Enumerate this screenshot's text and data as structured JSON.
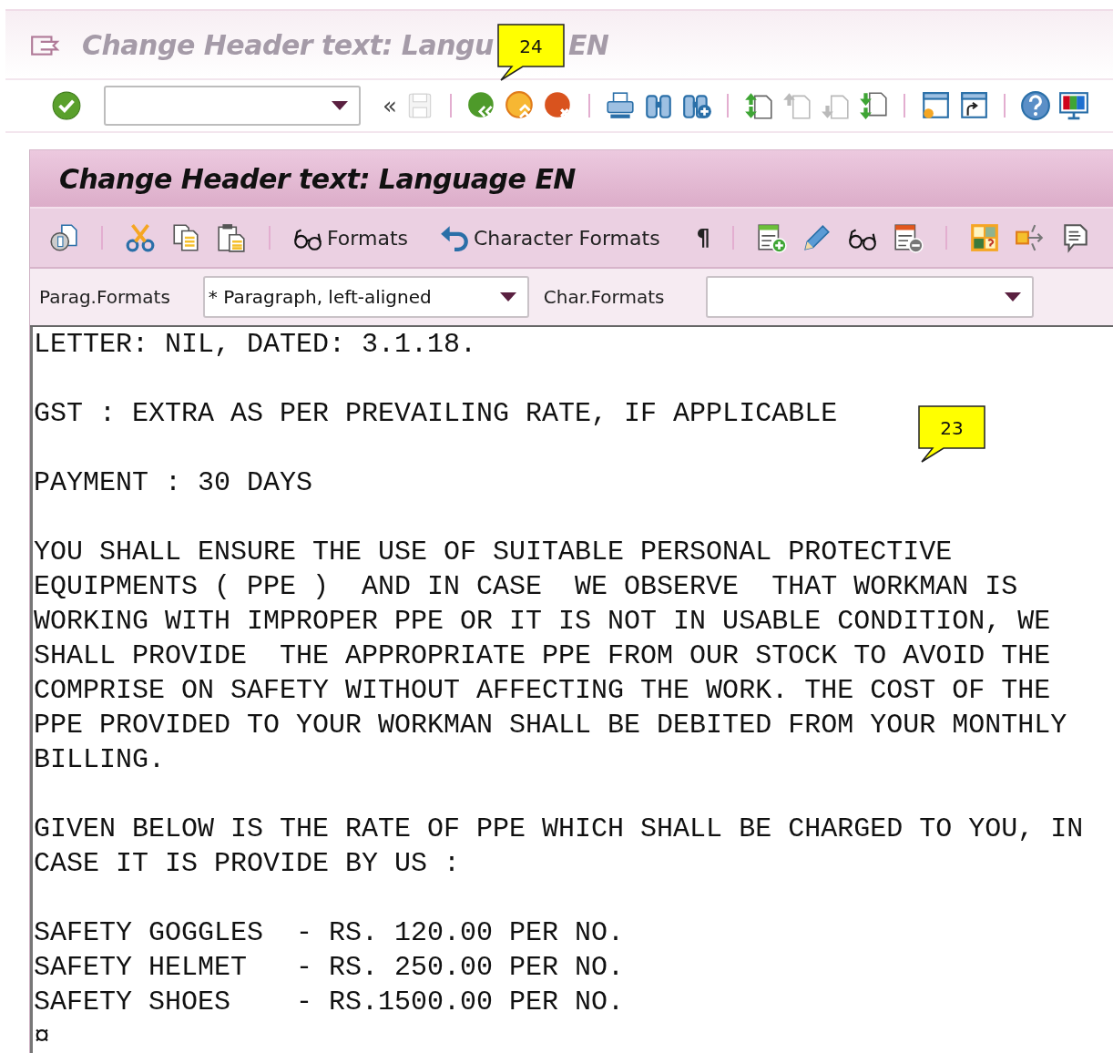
{
  "window": {
    "title": "Change Header text: Langu",
    "title_end": "EN"
  },
  "toolbar": {
    "nav_glyph": "«",
    "buttons": [
      {
        "disabled": false
      },
      {
        "disabled": true
      },
      {
        "disabled": false
      },
      {
        "disabled": false
      },
      {
        "disabled": false
      },
      {
        "disabled": false
      },
      {
        "disabled": false
      },
      {
        "disabled": false
      },
      {
        "disabled": false
      },
      {
        "disabled": true
      },
      {
        "disabled": true
      },
      {
        "disabled": false
      },
      {
        "disabled": false
      },
      {
        "disabled": false
      },
      {
        "disabled": false
      },
      {
        "disabled": false
      }
    ]
  },
  "callouts": [
    {
      "text": "24"
    },
    {
      "text": "23"
    }
  ],
  "screen": {
    "title": "Change Header text: Language EN"
  },
  "app_toolbar": {
    "formats_button": "Formats",
    "char_formats_button": "Character Formats",
    "paragraph_mark": "¶"
  },
  "format_bar": {
    "parag_label": "Parag.Formats",
    "parag_value": "* Paragraph, left-aligned",
    "char_label": "Char.Formats"
  },
  "editor": {
    "paragraphs": [
      [
        "LETTER: NIL, DATED: 3.1.18."
      ],
      [
        "GST : EXTRA AS PER PREVAILING RATE, IF APPLICABLE"
      ],
      [
        "PAYMENT : 30 DAYS"
      ],
      [
        "YOU SHALL ENSURE THE USE OF SUITABLE PERSONAL PROTECTIVE",
        "EQUIPMENTS ( PPE )  AND IN CASE  WE OBSERVE  THAT WORKMAN IS",
        "WORKING WITH IMPROPER PPE OR IT IS NOT IN USABLE CONDITION, WE",
        "SHALL PROVIDE  THE APPROPRIATE PPE FROM OUR STOCK TO AVOID THE",
        "COMPRISE ON SAFETY WITHOUT AFFECTING THE WORK. THE COST OF THE",
        "PPE PROVIDED TO YOUR WORKMAN SHALL BE DEBITED FROM YOUR MONTHLY",
        "BILLING."
      ],
      [
        "GIVEN BELOW IS THE RATE OF PPE WHICH SHALL BE CHARGED TO YOU, IN",
        "CASE IT IS PROVIDE BY US :"
      ],
      [
        "SAFETY GOGGLES  - RS. 120.00 PER NO.",
        "SAFETY HELMET   - RS. 250.00 PER NO.",
        "SAFETY SHOES    - RS.1500.00 PER NO.",
        "¤"
      ]
    ]
  }
}
